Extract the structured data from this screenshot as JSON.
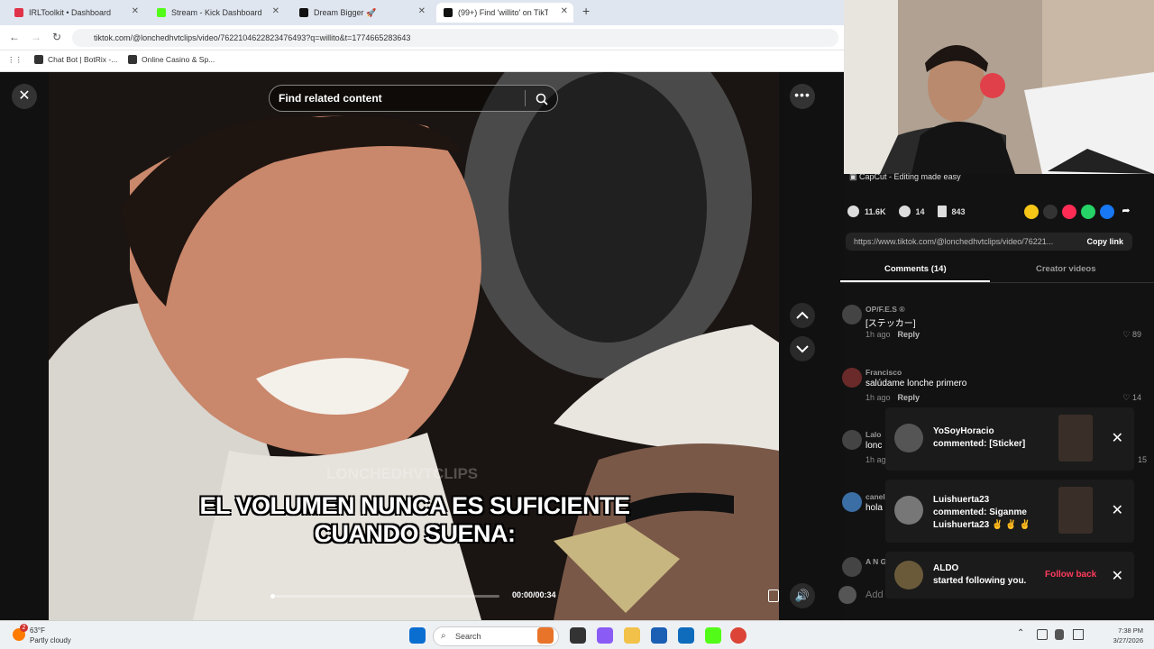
{
  "browser": {
    "tabs": [
      {
        "label": "IRLToolkit • Dashboard",
        "color": "#e0334a"
      },
      {
        "label": "Stream - Kick Dashboard",
        "color": "#53fc18"
      },
      {
        "label": "Dream Bigger 🚀",
        "color": "#111111"
      },
      {
        "label": "(99+) Find 'willito' on TikTok",
        "color": "#111111"
      }
    ],
    "url": "tiktok.com/@lonchedhvtclips/video/7622104622823476493?q=willito&t=1774665283643",
    "bookmarks": [
      "Chat Bot | BotRix -...",
      "Online Casino & Sp..."
    ]
  },
  "player": {
    "search_placeholder": "Find related content",
    "caption_line1": "EL VOLUMEN NUNCA ES SUFICIENTE",
    "caption_line2": "CUANDO SUENA:",
    "watermark": "LONCHEDHVTCLIPS",
    "time": "00:00/00:34",
    "progress": 0.0
  },
  "sidebar": {
    "sponsor": "CapCut - Editing made easy",
    "likes": "11.6K",
    "comments_count": "14",
    "saves": "843",
    "link": "https://www.tiktok.com/@lonchedhvtclips/video/76221...",
    "copy_label": "Copy link",
    "tab_comments": "Comments (14)",
    "tab_creator": "Creator videos",
    "comments": [
      {
        "user": "OP/F.E.S ®",
        "text": "[ステッカー]",
        "time": "1h ago",
        "reply": "Reply",
        "likes": "89"
      },
      {
        "user": "Francisco",
        "text": "salúdame lonche primero",
        "time": "1h ago",
        "reply": "Reply",
        "likes": "14"
      },
      {
        "user": "Lalo",
        "text": "lonc",
        "time": "1h ag",
        "reply": "",
        "likes": "15"
      },
      {
        "user": "canel",
        "text": "hola",
        "time": "",
        "reply": "",
        "likes": ""
      },
      {
        "user": "A N G",
        "text": "",
        "time": "",
        "reply": "",
        "likes": ""
      }
    ],
    "add_comment": "Add"
  },
  "notifications": [
    {
      "name": "YoSoyHoracio",
      "text": "commented: [Sticker]"
    },
    {
      "name": "Luishuerta23",
      "text": "commented: Siganme Luishuerta23 ✌ ✌ ✌"
    },
    {
      "name": "ALDO",
      "text": "started following you.",
      "action": "Follow back"
    }
  ],
  "taskbar": {
    "temp": "63°F",
    "weather": "Partly cloudy",
    "search": "Search",
    "time": "7:38 PM",
    "date": "3/27/2026",
    "notif_badge": "2"
  }
}
